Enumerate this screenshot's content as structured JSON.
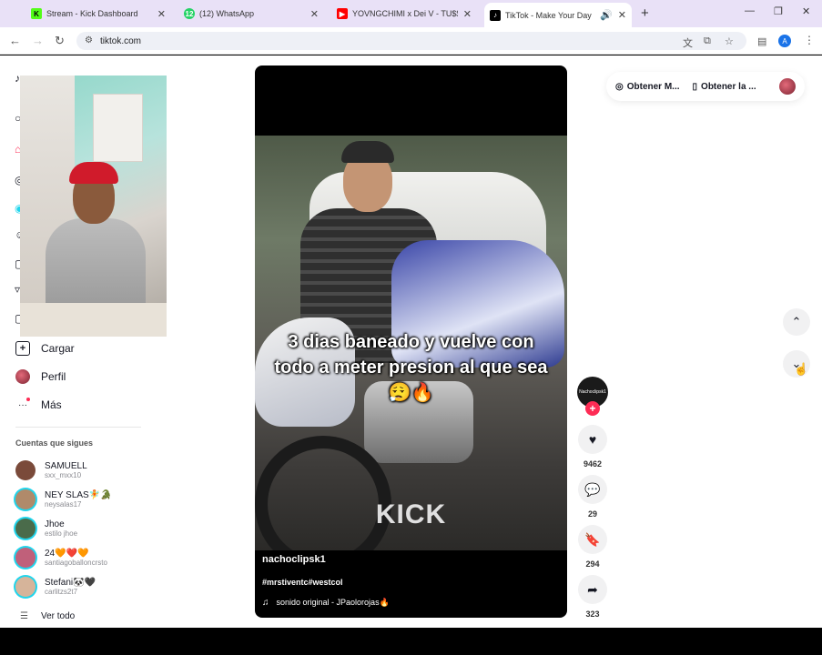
{
  "browser": {
    "tabs": [
      {
        "label": "Stream - Kick Dashboard",
        "favicon": "K",
        "color": "#53fc18"
      },
      {
        "label": "(12) WhatsApp",
        "favicon": "12",
        "color": "#25d366"
      },
      {
        "label": "YOVNGCHIMI x Dei V - TU$$! (",
        "favicon": "▶",
        "color": "#ff0000"
      },
      {
        "label": "TikTok - Make Your Day",
        "favicon": "♪",
        "color": "#000000",
        "active": true
      }
    ],
    "url": "tiktok.com",
    "profile_initial": "A"
  },
  "sidebar": {
    "upload_label": "Cargar",
    "profile_label": "Perfil",
    "more_label": "Más",
    "following_title": "Cuentas que sigues",
    "accounts": [
      {
        "name": "SAMUELL",
        "handle": "sxx_mxx10",
        "color": "#7a4a3a"
      },
      {
        "name": "NEY SLAS🧚🐊",
        "handle": "neysalas17",
        "color": "#b08a6a"
      },
      {
        "name": "Jhoe",
        "handle": "estilo jhoe",
        "color": "#4a6b4a"
      },
      {
        "name": "24🧡❤️🧡",
        "handle": "santiagoballoncrsto",
        "color": "#c0607a"
      },
      {
        "name": "Stefani🐼🖤",
        "handle": "carlitzs2t7",
        "color": "#d6b49a"
      }
    ],
    "see_all_label": "Ver todo"
  },
  "video": {
    "caption": "3 dias baneado y vuelve con todo a meter presion al que sea😮‍💨🔥",
    "watermark": "KICK",
    "author": "nachoclipsk1",
    "tags": "#mrstiventc#westcol",
    "sound": "sonido original - JPaolorojas🔥"
  },
  "actions": {
    "creator_label": "Nachoclipsk1",
    "likes": "9462",
    "comments": "29",
    "saves": "294",
    "shares": "323"
  },
  "top_pills": {
    "first": "Obtener M...",
    "second": "Obtener la ..."
  },
  "colors": {
    "accent": "#fe2c55",
    "ring": "#20d5ec"
  }
}
